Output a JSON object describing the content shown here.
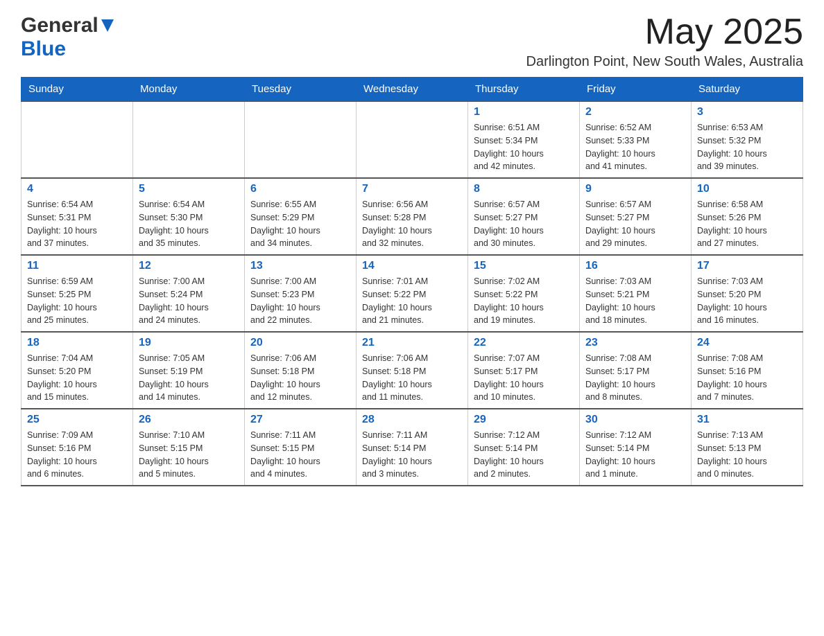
{
  "header": {
    "logo_line1": "General",
    "logo_arrow": "▶",
    "logo_line2": "Blue",
    "month_title": "May 2025",
    "location": "Darlington Point, New South Wales, Australia"
  },
  "days_of_week": [
    "Sunday",
    "Monday",
    "Tuesday",
    "Wednesday",
    "Thursday",
    "Friday",
    "Saturday"
  ],
  "weeks": [
    [
      {
        "day": "",
        "info": ""
      },
      {
        "day": "",
        "info": ""
      },
      {
        "day": "",
        "info": ""
      },
      {
        "day": "",
        "info": ""
      },
      {
        "day": "1",
        "info": "Sunrise: 6:51 AM\nSunset: 5:34 PM\nDaylight: 10 hours\nand 42 minutes."
      },
      {
        "day": "2",
        "info": "Sunrise: 6:52 AM\nSunset: 5:33 PM\nDaylight: 10 hours\nand 41 minutes."
      },
      {
        "day": "3",
        "info": "Sunrise: 6:53 AM\nSunset: 5:32 PM\nDaylight: 10 hours\nand 39 minutes."
      }
    ],
    [
      {
        "day": "4",
        "info": "Sunrise: 6:54 AM\nSunset: 5:31 PM\nDaylight: 10 hours\nand 37 minutes."
      },
      {
        "day": "5",
        "info": "Sunrise: 6:54 AM\nSunset: 5:30 PM\nDaylight: 10 hours\nand 35 minutes."
      },
      {
        "day": "6",
        "info": "Sunrise: 6:55 AM\nSunset: 5:29 PM\nDaylight: 10 hours\nand 34 minutes."
      },
      {
        "day": "7",
        "info": "Sunrise: 6:56 AM\nSunset: 5:28 PM\nDaylight: 10 hours\nand 32 minutes."
      },
      {
        "day": "8",
        "info": "Sunrise: 6:57 AM\nSunset: 5:27 PM\nDaylight: 10 hours\nand 30 minutes."
      },
      {
        "day": "9",
        "info": "Sunrise: 6:57 AM\nSunset: 5:27 PM\nDaylight: 10 hours\nand 29 minutes."
      },
      {
        "day": "10",
        "info": "Sunrise: 6:58 AM\nSunset: 5:26 PM\nDaylight: 10 hours\nand 27 minutes."
      }
    ],
    [
      {
        "day": "11",
        "info": "Sunrise: 6:59 AM\nSunset: 5:25 PM\nDaylight: 10 hours\nand 25 minutes."
      },
      {
        "day": "12",
        "info": "Sunrise: 7:00 AM\nSunset: 5:24 PM\nDaylight: 10 hours\nand 24 minutes."
      },
      {
        "day": "13",
        "info": "Sunrise: 7:00 AM\nSunset: 5:23 PM\nDaylight: 10 hours\nand 22 minutes."
      },
      {
        "day": "14",
        "info": "Sunrise: 7:01 AM\nSunset: 5:22 PM\nDaylight: 10 hours\nand 21 minutes."
      },
      {
        "day": "15",
        "info": "Sunrise: 7:02 AM\nSunset: 5:22 PM\nDaylight: 10 hours\nand 19 minutes."
      },
      {
        "day": "16",
        "info": "Sunrise: 7:03 AM\nSunset: 5:21 PM\nDaylight: 10 hours\nand 18 minutes."
      },
      {
        "day": "17",
        "info": "Sunrise: 7:03 AM\nSunset: 5:20 PM\nDaylight: 10 hours\nand 16 minutes."
      }
    ],
    [
      {
        "day": "18",
        "info": "Sunrise: 7:04 AM\nSunset: 5:20 PM\nDaylight: 10 hours\nand 15 minutes."
      },
      {
        "day": "19",
        "info": "Sunrise: 7:05 AM\nSunset: 5:19 PM\nDaylight: 10 hours\nand 14 minutes."
      },
      {
        "day": "20",
        "info": "Sunrise: 7:06 AM\nSunset: 5:18 PM\nDaylight: 10 hours\nand 12 minutes."
      },
      {
        "day": "21",
        "info": "Sunrise: 7:06 AM\nSunset: 5:18 PM\nDaylight: 10 hours\nand 11 minutes."
      },
      {
        "day": "22",
        "info": "Sunrise: 7:07 AM\nSunset: 5:17 PM\nDaylight: 10 hours\nand 10 minutes."
      },
      {
        "day": "23",
        "info": "Sunrise: 7:08 AM\nSunset: 5:17 PM\nDaylight: 10 hours\nand 8 minutes."
      },
      {
        "day": "24",
        "info": "Sunrise: 7:08 AM\nSunset: 5:16 PM\nDaylight: 10 hours\nand 7 minutes."
      }
    ],
    [
      {
        "day": "25",
        "info": "Sunrise: 7:09 AM\nSunset: 5:16 PM\nDaylight: 10 hours\nand 6 minutes."
      },
      {
        "day": "26",
        "info": "Sunrise: 7:10 AM\nSunset: 5:15 PM\nDaylight: 10 hours\nand 5 minutes."
      },
      {
        "day": "27",
        "info": "Sunrise: 7:11 AM\nSunset: 5:15 PM\nDaylight: 10 hours\nand 4 minutes."
      },
      {
        "day": "28",
        "info": "Sunrise: 7:11 AM\nSunset: 5:14 PM\nDaylight: 10 hours\nand 3 minutes."
      },
      {
        "day": "29",
        "info": "Sunrise: 7:12 AM\nSunset: 5:14 PM\nDaylight: 10 hours\nand 2 minutes."
      },
      {
        "day": "30",
        "info": "Sunrise: 7:12 AM\nSunset: 5:14 PM\nDaylight: 10 hours\nand 1 minute."
      },
      {
        "day": "31",
        "info": "Sunrise: 7:13 AM\nSunset: 5:13 PM\nDaylight: 10 hours\nand 0 minutes."
      }
    ]
  ]
}
